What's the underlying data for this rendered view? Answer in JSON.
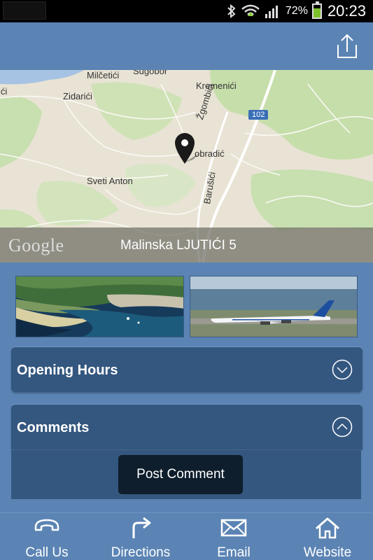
{
  "status_bar": {
    "battery_percent": "72%",
    "battery_level": 0.72,
    "time": "20:23",
    "icons": [
      "bluetooth-icon",
      "wifi-icon",
      "signal-icon",
      "battery-icon"
    ]
  },
  "header": {
    "share_icon": "share-icon"
  },
  "map": {
    "labels": {
      "milcetici": "Milčetići",
      "zidarici": "Zidarići",
      "kremenici": "Kremenići",
      "zgombici": "Žgombići",
      "road_102": "102",
      "sobradic": "obradić",
      "sveti_anton": "Sveti Anton",
      "barusici": "Barušići",
      "partial_top": "Sugobor",
      "partial_left": "ići"
    },
    "logo": "Google",
    "address": "Malinska LJUTIĆI 5"
  },
  "photos": [
    "harbor-photo",
    "airplane-photo"
  ],
  "sections": {
    "opening_hours": "Opening Hours",
    "comments": "Comments"
  },
  "comments": {
    "post_button": "Post Comment"
  },
  "bottom_nav": {
    "call": "Call Us",
    "directions": "Directions",
    "email": "Email",
    "website": "Website"
  },
  "colors": {
    "background": "#5b84b4",
    "panel": "#34577f",
    "button_dark": "#0e1e2c",
    "status_bar": "#000000"
  }
}
